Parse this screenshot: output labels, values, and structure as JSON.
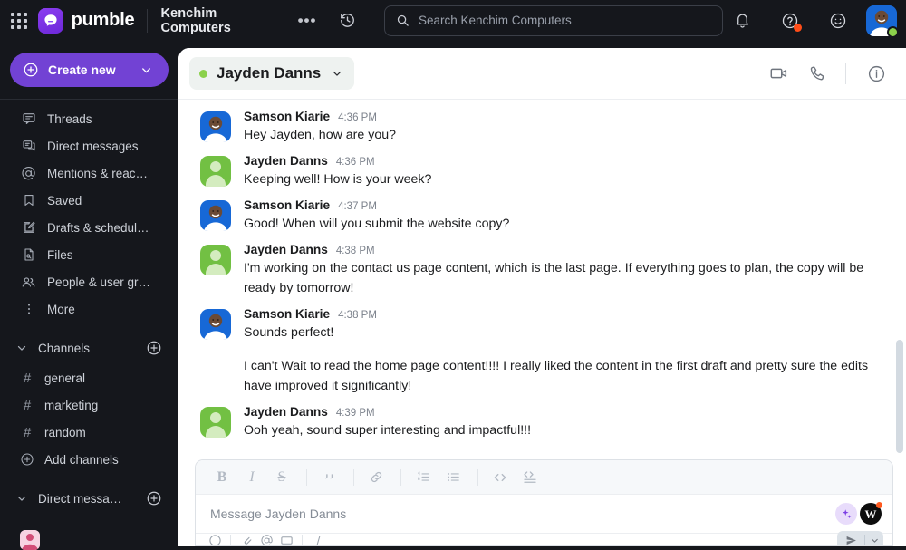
{
  "topbar": {
    "apps_icon": "grid-apps-icon",
    "brand_name": "pumble",
    "workspace_name": "Kenchim Computers",
    "workspace_more_label": "•••",
    "history_icon": "history-clock-icon",
    "search": {
      "icon": "search-icon",
      "placeholder": "Search Kenchim Computers",
      "value": ""
    },
    "notifications_icon": "bell-icon",
    "help_icon": "question-circle-icon",
    "emoji_status_icon": "smiley-face-icon",
    "avatar_name": "user-avatar",
    "presence": "online",
    "presence_color": "#8bd14b",
    "badge_color": "#ff4d18"
  },
  "sidebar": {
    "create_new": {
      "label": "Create new",
      "plus_icon": "plus-circle-icon",
      "chevron_icon": "chevron-down-icon",
      "color": "#7242d4"
    },
    "nav_items": [
      {
        "label": "Threads",
        "icon": "threads-icon"
      },
      {
        "label": "Direct messages",
        "icon": "direct-messages-icon"
      },
      {
        "label": "Mentions & reac…",
        "icon": "at-mention-icon"
      },
      {
        "label": "Saved",
        "icon": "bookmark-icon"
      },
      {
        "label": "Drafts & schedul…",
        "icon": "draft-pencil-icon"
      },
      {
        "label": "Files",
        "icon": "file-search-icon"
      },
      {
        "label": "People & user gr…",
        "icon": "people-icon"
      },
      {
        "label": "More",
        "icon": "more-vertical-icon"
      }
    ],
    "channels_section": {
      "label": "Channels",
      "chevron_icon": "chevron-down-icon",
      "add_icon": "plus-circle-icon",
      "items": [
        {
          "label": "general",
          "icon": "hash-icon"
        },
        {
          "label": "marketing",
          "icon": "hash-icon"
        },
        {
          "label": "random",
          "icon": "hash-icon"
        }
      ],
      "add_channels_label": "Add channels",
      "add_channels_icon": "plus-circle-icon"
    },
    "dm_section": {
      "label": "Direct messa…",
      "chevron_icon": "chevron-down-icon",
      "add_icon": "plus-circle-icon",
      "items": [
        {
          "label": "",
          "icon": "avatar"
        }
      ]
    }
  },
  "chat": {
    "header": {
      "title": "Jayden Danns",
      "presence": "online",
      "presence_color": "#8bd14b",
      "chevron_icon": "chevron-down-icon",
      "video_icon": "video-camera-icon",
      "call_icon": "phone-icon",
      "info_icon": "info-circle-icon"
    },
    "messages": [
      {
        "author": "Samson Kiarie",
        "time": "4:36 PM",
        "text": "Hey Jayden, how are you?",
        "avatar": "photo",
        "continuation": false
      },
      {
        "author": "Jayden Danns",
        "time": "4:36 PM",
        "text": "Keeping well! How is your week?",
        "avatar": "green",
        "continuation": false
      },
      {
        "author": "Samson Kiarie",
        "time": "4:37 PM",
        "text": "Good! When will you submit the website copy?",
        "avatar": "photo",
        "continuation": false
      },
      {
        "author": "Jayden Danns",
        "time": "4:38 PM",
        "text": "I'm working on the contact us page content, which is the last page. If everything goes to plan, the copy will be ready by tomorrow!",
        "avatar": "green",
        "continuation": false
      },
      {
        "author": "Samson Kiarie",
        "time": "4:38 PM",
        "text": "Sounds perfect!",
        "avatar": "photo",
        "continuation": false
      },
      {
        "author": "Samson Kiarie",
        "time": "",
        "text": "I can't Wait to read the home page content!!!! I really liked the content in the first draft and pretty sure the edits have improved it significantly!",
        "avatar": "photo",
        "continuation": true
      },
      {
        "author": "Jayden Danns",
        "time": "4:39 PM",
        "text": "Ooh yeah, sound super interesting and impactful!!!",
        "avatar": "green",
        "continuation": false
      }
    ]
  },
  "composer": {
    "format_buttons": [
      {
        "name": "bold",
        "glyph": "B"
      },
      {
        "name": "italic",
        "glyph": "I"
      },
      {
        "name": "strikethrough",
        "glyph": "S"
      },
      {
        "name": "blockquote",
        "glyph": "“"
      },
      {
        "name": "link",
        "glyph": "🔗"
      },
      {
        "name": "ordered-list",
        "glyph": "1."
      },
      {
        "name": "bulleted-list",
        "glyph": "•"
      },
      {
        "name": "code",
        "glyph": "<>"
      },
      {
        "name": "code-block",
        "glyph": "</>"
      }
    ],
    "placeholder": "Message Jayden Danns",
    "value": "",
    "ai_badge_icon": "ai-sparkle-icon",
    "w_badge_letter": "W",
    "w_badge_notification_color": "#ff5a1f"
  }
}
